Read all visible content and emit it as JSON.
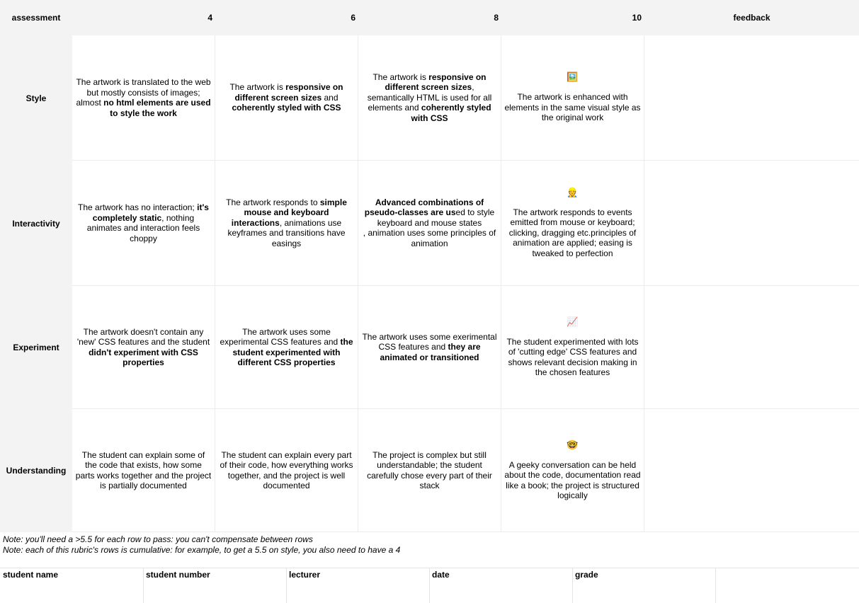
{
  "header": {
    "assessment": "assessment",
    "score_4": "4",
    "score_6": "6",
    "score_8": "8",
    "score_10": "10",
    "feedback": "feedback"
  },
  "rows": [
    {
      "label": "Style",
      "cells": [
        [
          {
            "t": "The artwork is translated to the web but mostly consists of images; almost "
          },
          {
            "t": "no html elements are used to style the work",
            "b": true
          }
        ],
        [
          {
            "t": "The artwork is "
          },
          {
            "t": "responsive on different screen sizes",
            "b": true
          },
          {
            "t": " and "
          },
          {
            "t": "coherently styled with CSS",
            "b": true
          }
        ],
        [
          {
            "t": "The artwork is "
          },
          {
            "t": "responsive on different screen sizes",
            "b": true
          },
          {
            "t": ", semantically HTML is used for all elements and "
          },
          {
            "t": "coherently styled with CSS",
            "b": true
          }
        ],
        [
          {
            "t": "The artwork is enhanced with elements in the same visual style as the original work"
          }
        ]
      ],
      "icon": "🖼️"
    },
    {
      "label": "Interactivity",
      "cells": [
        [
          {
            "t": "The artwork has no interaction; "
          },
          {
            "t": "it's completely static",
            "b": true
          },
          {
            "t": ", nothing animates and interaction feels choppy"
          }
        ],
        [
          {
            "t": "The artwork responds to "
          },
          {
            "t": "simple mouse and keyboard interactions",
            "b": true
          },
          {
            "t": ", animations use keyframes and transitions have easings"
          }
        ],
        [
          {
            "t": "Advanced combinations of pseudo-classes are us",
            "b": true
          },
          {
            "t": "ed to style keyboard and mouse states\n, animation uses some principles of animation"
          }
        ],
        [
          {
            "t": "The artwork responds to events emitted from mouse or keyboard; clicking, dragging etc.principles of animation are applied; easing is tweaked to perfection"
          }
        ]
      ],
      "icon": "👷"
    },
    {
      "label": "Experiment",
      "cells": [
        [
          {
            "t": "The artwork doesn't contain any 'new' CSS features and the student "
          },
          {
            "t": "didn't experiment with CSS properties",
            "b": true
          }
        ],
        [
          {
            "t": "The artwork uses some experimental CSS features and "
          },
          {
            "t": "the student experimented with different CSS properties",
            "b": true
          }
        ],
        [
          {
            "t": "The artwork uses some exerimental CSS features and "
          },
          {
            "t": "they are animated or transitioned",
            "b": true
          }
        ],
        [
          {
            "t": "The student experimented with lots of 'cutting edge' CSS features and shows relevant decision making in the chosen features"
          }
        ]
      ],
      "icon": "📈"
    },
    {
      "label": "Understanding",
      "cells": [
        [
          {
            "t": "The student can explain some of the code that exists, how some parts works together and the project is partially documented"
          }
        ],
        [
          {
            "t": "The student can explain every part of their code, how everything works together, and the project is well documented"
          }
        ],
        [
          {
            "t": "The project is complex but still understandable; the student carefully chose every part of their stack"
          }
        ],
        [
          {
            "t": "A geeky conversation can be held about the code, documentation read like a book; the project is structured logically"
          }
        ]
      ],
      "icon": "🤓"
    }
  ],
  "notes": [
    "Note: you'll need a >5.5 for each row to pass: you can't compensate between rows",
    "Note: each of this rubric's rows is cumulative: for example, to get a 5.5 on style, you also need to have a 4"
  ],
  "footer": {
    "student_name": "student name",
    "student_number": "student number",
    "lecturer": "lecturer",
    "date": "date",
    "grade": "grade"
  }
}
